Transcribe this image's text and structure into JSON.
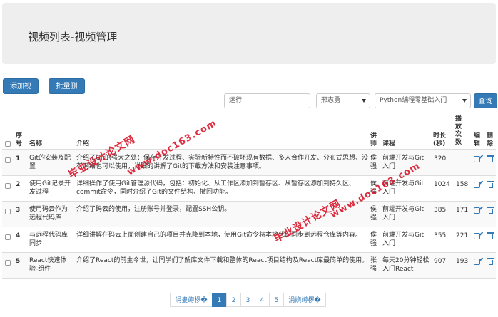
{
  "header": {
    "title": "视频列表-视频管理"
  },
  "toolbar": {
    "add_label": "添加视频",
    "batch_delete_label": "批量删除"
  },
  "filters": {
    "search_value": "运行",
    "teacher_value": "邢志勇",
    "course_value": "Python编程零基础入门",
    "query_label": "查询"
  },
  "table": {
    "headers": {
      "seq": "序号",
      "name": "名称",
      "intro": "介绍",
      "teacher": "讲师",
      "course": "课程",
      "duration": "时长(秒)",
      "plays": "播放次数",
      "edit": "编辑",
      "delete": "删除"
    },
    "rows": [
      {
        "seq": "1",
        "name": "Git的安装及配置",
        "intro": "介绍了Git的强大之处：保存开发过程、实验新特性而不破坏现有数据、多人合作开发、分布式思想、没有网络也可以使用，详细的讲解了Git的下载方法和安装注意事项。",
        "teacher": "侯强",
        "course": "前端开发与Git入门",
        "duration": "320",
        "plays": ""
      },
      {
        "seq": "2",
        "name": "使用Git记录开发过程",
        "intro": "详细操作了使用Git管理源代码，包括：初始化、从工作区添加到暂存区、从暂存区添加到持久区、commit命令，同时介绍了Git的文件结构、撤回功能。",
        "teacher": "侯强",
        "course": "前端开发与Git入门",
        "duration": "1024",
        "plays": "158"
      },
      {
        "seq": "3",
        "name": "使用码云作为远程代码库",
        "intro": "介绍了码云的使用，注册账号并登录，配置SSH公钥。",
        "teacher": "侯强",
        "course": "前端开发与Git入门",
        "duration": "385",
        "plays": "171"
      },
      {
        "seq": "4",
        "name": "与远程代码库同步",
        "intro": "详细讲解在码云上面创建自己的项目并克隆到本地，使用Git命令将本地代码同步到远程仓库等内容。",
        "teacher": "侯强",
        "course": "前端开发与Git入门",
        "duration": "355",
        "plays": "221"
      },
      {
        "seq": "5",
        "name": "React快速体验-组件",
        "intro": "介绍了React的前生今世，让同学们了解库文件下载和整体的React项目结构及React库最简单的使用。",
        "teacher": "张强",
        "course": "每天20分钟轻松入门React",
        "duration": "907",
        "plays": "193"
      }
    ]
  },
  "pagination": {
    "prev_label": "涓婁竴椤�",
    "pages": [
      "1",
      "2",
      "3",
      "4",
      "5"
    ],
    "next_label": "涓嬩竴椤�",
    "active_page": "1"
  },
  "watermark": {
    "text1": "毕业设计论文网",
    "text2": "www.doc163.com"
  },
  "colors": {
    "primary": "#337ab7",
    "panel": "#eeeeee",
    "watermark": "#d9182d"
  }
}
